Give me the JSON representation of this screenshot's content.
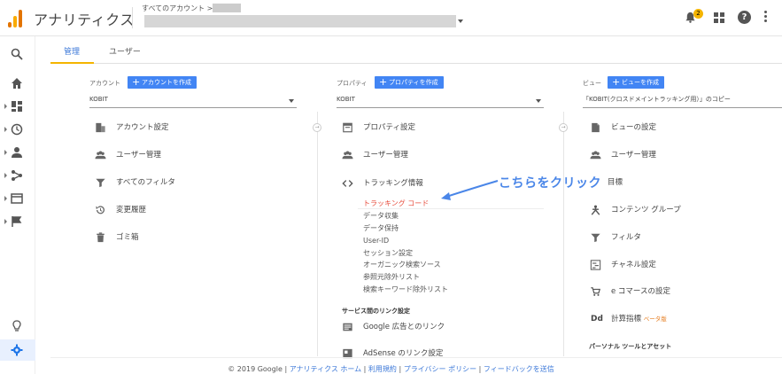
{
  "header": {
    "app_title": "アナリティクス",
    "account_crumb": "すべてのアカウント >",
    "notification_count": "2",
    "help_label": "?"
  },
  "tabs": [
    {
      "label": "管理",
      "active": true
    },
    {
      "label": "ユーザー",
      "active": false
    }
  ],
  "account_col": {
    "label": "アカウント",
    "create_label": "アカウントを作成",
    "selected": "KOBIT",
    "items": [
      {
        "label": "アカウント設定",
        "icon": "building-icon"
      },
      {
        "label": "ユーザー管理",
        "icon": "people-icon"
      },
      {
        "label": "すべてのフィルタ",
        "icon": "filter-icon"
      },
      {
        "label": "変更履歴",
        "icon": "history-icon"
      },
      {
        "label": "ゴミ箱",
        "icon": "trash-icon"
      }
    ]
  },
  "property_col": {
    "label": "プロパティ",
    "create_label": "プロパティを作成",
    "selected": "KOBIT",
    "items": [
      {
        "label": "プロパティ設定",
        "icon": "property-icon"
      },
      {
        "label": "ユーザー管理",
        "icon": "people-icon"
      },
      {
        "label": "トラッキング情報",
        "icon": "code-icon"
      }
    ],
    "tracking_sub": [
      "トラッキング コード",
      "データ収集",
      "データ保持",
      "User-ID",
      "セッション設定",
      "オーガニック検索ソース",
      "参照元除外リスト",
      "検索キーワード除外リスト"
    ],
    "links_heading": "サービス間のリンク設定",
    "links": [
      {
        "label": "Google 広告とのリンク",
        "icon": "ads-icon"
      },
      {
        "label": "AdSense のリンク設定",
        "icon": "adsense-icon"
      }
    ]
  },
  "view_col": {
    "label": "ビュー",
    "create_label": "ビューを作成",
    "selected": "「KOBIT(クロスドメイントラッキング用）」のコピー",
    "items": [
      {
        "label": "ビューの設定",
        "icon": "document-icon"
      },
      {
        "label": "ユーザー管理",
        "icon": "people-icon"
      },
      {
        "label": "目標",
        "icon": "goal-icon"
      },
      {
        "label": "コンテンツ グループ",
        "icon": "content-group-icon"
      },
      {
        "label": "フィルタ",
        "icon": "filter-icon"
      },
      {
        "label": "チャネル設定",
        "icon": "channel-icon"
      },
      {
        "label": "e コマースの設定",
        "icon": "cart-icon"
      },
      {
        "label": "計算指標",
        "icon": "calc-icon"
      }
    ],
    "beta": "ベータ版",
    "section_heading": "パーソナル ツールとアセット"
  },
  "annotation": "こちらをクリック",
  "footer": {
    "copyright": "© 2019 Google",
    "links": [
      "アナリティクス ホーム",
      "利用規約",
      "プライバシー ポリシー",
      "フィードバックを送信"
    ]
  },
  "colors": {
    "accent_blue": "#4285f4",
    "tab_underline": "#f4b400",
    "highlight_red": "#e74c3c",
    "annotation_blue": "#4a86e8"
  }
}
